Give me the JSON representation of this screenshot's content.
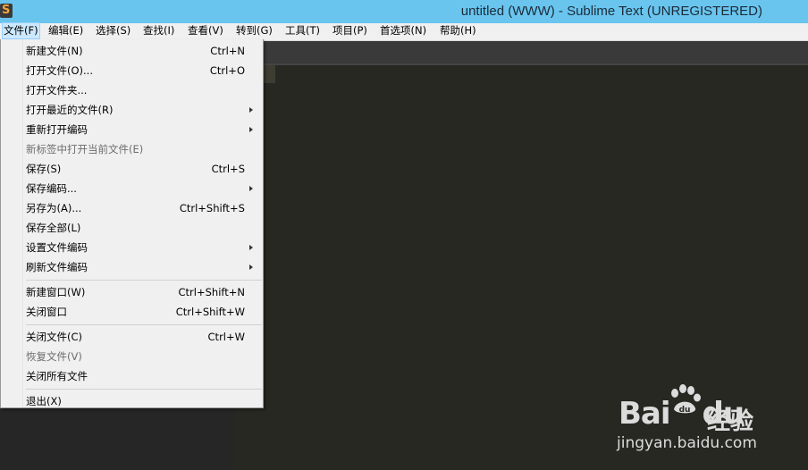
{
  "window": {
    "title": "untitled (WWW) - Sublime Text (UNREGISTERED)"
  },
  "menubar": [
    {
      "label": "文件(F)",
      "active": true
    },
    {
      "label": "编辑(E)"
    },
    {
      "label": "选择(S)"
    },
    {
      "label": "查找(I)"
    },
    {
      "label": "查看(V)"
    },
    {
      "label": "转到(G)"
    },
    {
      "label": "工具(T)"
    },
    {
      "label": "项目(P)"
    },
    {
      "label": "首选项(N)"
    },
    {
      "label": "帮助(H)"
    }
  ],
  "file_menu": [
    {
      "label": "新建文件(N)",
      "shortcut": "Ctrl+N"
    },
    {
      "label": "打开文件(O)...",
      "shortcut": "Ctrl+O"
    },
    {
      "label": "打开文件夹..."
    },
    {
      "label": "打开最近的文件(R)",
      "submenu": true
    },
    {
      "label": "重新打开编码",
      "submenu": true
    },
    {
      "label": "新标签中打开当前文件(E)",
      "disabled": true
    },
    {
      "label": "保存(S)",
      "shortcut": "Ctrl+S"
    },
    {
      "label": "保存编码...",
      "submenu": true
    },
    {
      "label": "另存为(A)...",
      "shortcut": "Ctrl+Shift+S"
    },
    {
      "label": "保存全部(L)"
    },
    {
      "label": "设置文件编码",
      "submenu": true
    },
    {
      "label": "刷新文件编码",
      "submenu": true
    },
    {
      "separator": true
    },
    {
      "label": "新建窗口(W)",
      "shortcut": "Ctrl+Shift+N"
    },
    {
      "label": "关闭窗口",
      "shortcut": "Ctrl+Shift+W"
    },
    {
      "separator": true
    },
    {
      "label": "关闭文件(C)",
      "shortcut": "Ctrl+W"
    },
    {
      "label": "恢复文件(V)",
      "disabled": true
    },
    {
      "label": "关闭所有文件"
    },
    {
      "separator": true
    },
    {
      "label": "退出(X)"
    }
  ],
  "watermark": {
    "logo": "Bai",
    "logo2": "du",
    "cn": "经验",
    "url": "jingyan.baidu.com"
  },
  "icons": {
    "app": "sublime-text-icon",
    "submenu": "chevron-right-icon",
    "watermark": "baidu-paw-icon"
  }
}
